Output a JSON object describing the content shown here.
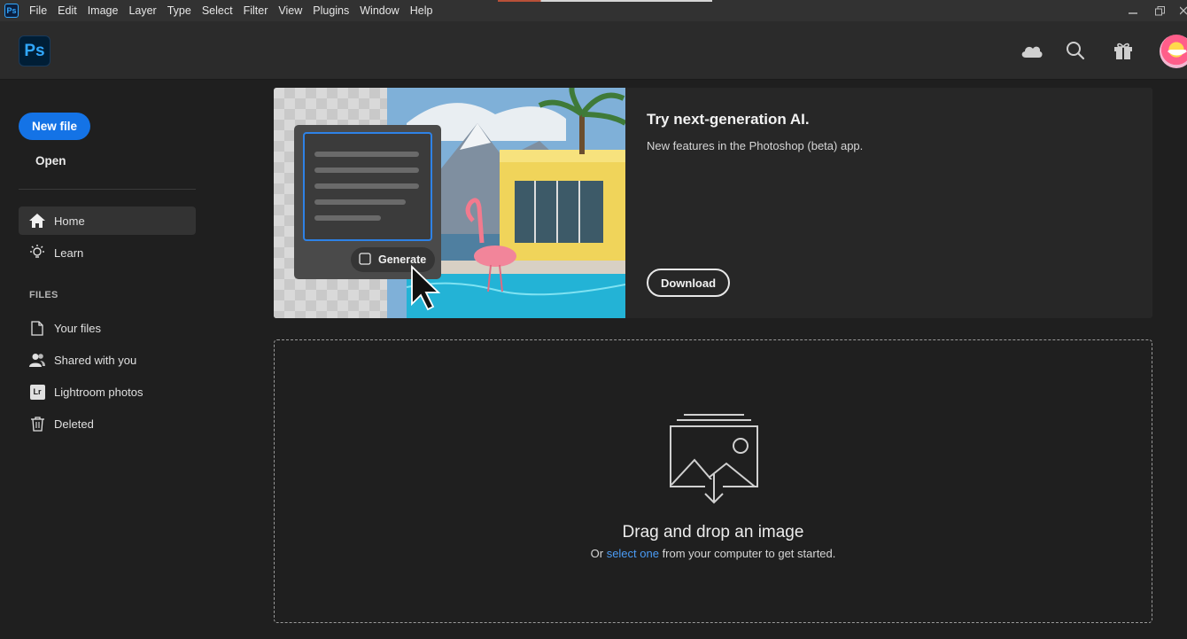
{
  "menubar": {
    "app_icon_label": "Ps",
    "items": [
      "File",
      "Edit",
      "Image",
      "Layer",
      "Type",
      "Select",
      "Filter",
      "View",
      "Plugins",
      "Window",
      "Help"
    ]
  },
  "header": {
    "logo_text": "Ps",
    "icons": [
      "cloud-icon",
      "search-icon",
      "gift-icon",
      "avatar"
    ]
  },
  "sidebar": {
    "new_file_label": "New file",
    "open_label": "Open",
    "nav": [
      {
        "label": "Home",
        "icon": "home-icon",
        "active": true
      },
      {
        "label": "Learn",
        "icon": "lightbulb-icon",
        "active": false
      }
    ],
    "files_section_label": "FILES",
    "files": [
      {
        "label": "Your files",
        "icon": "document-icon"
      },
      {
        "label": "Shared with you",
        "icon": "users-icon"
      },
      {
        "label": "Lightroom photos",
        "icon": "lightroom-icon",
        "badge": "Lr"
      },
      {
        "label": "Deleted",
        "icon": "trash-icon"
      }
    ]
  },
  "banner": {
    "title": "Try next-generation AI.",
    "subtitle": "New features in the Photoshop (beta) app.",
    "download_label": "Download",
    "generate_label": "Generate"
  },
  "dropzone": {
    "title": "Drag and drop an image",
    "sub_prefix": "Or ",
    "sub_link": "select one",
    "sub_suffix": " from your computer to get started."
  },
  "colors": {
    "accent_blue": "#1473e6",
    "link_blue": "#4b9cf5",
    "ps_blue": "#31a8ff"
  }
}
